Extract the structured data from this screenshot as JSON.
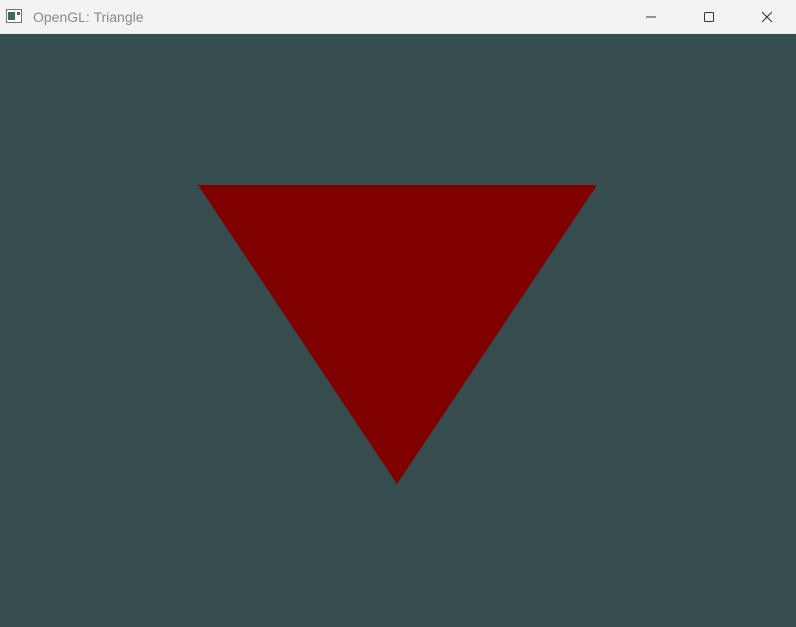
{
  "window": {
    "title": "OpenGL: Triangle",
    "icon": "application-window-icon",
    "controls": [
      "minimize-icon",
      "maximize-icon",
      "close-icon"
    ]
  },
  "scene": {
    "clear_color": "#354d4e",
    "triangle_color": "#800000",
    "titlebar_color": "#f3f3f3"
  }
}
